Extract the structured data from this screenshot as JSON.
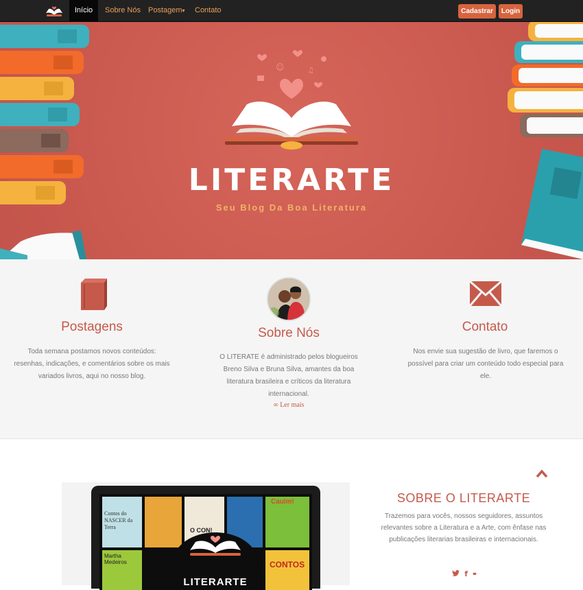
{
  "navbar": {
    "items": [
      "Início",
      "Sobre Nós",
      "Postagem",
      "Contato"
    ],
    "dropdown_caret": "▾",
    "register_label": "Cadastrar",
    "login_label": "Login"
  },
  "hero": {
    "title": "LITERARTE",
    "subtitle": "Seu Blog Da Boa Literatura"
  },
  "features": [
    {
      "icon": "book-icon",
      "title": "Postagens",
      "text": "Toda semana postamos novos conteúdos: resenhas, indicações, e comentários sobre os mais variados livros, aqui no nosso blog."
    },
    {
      "icon": "avatar",
      "title": "Sobre Nós",
      "text": "O LITERATE é administrado pelos blogueiros Breno Silva e Bruna Silva, amantes da boa literatura brasileira e críticos da literatura internacional.",
      "link": "Ler mais",
      "link_icon": "∞"
    },
    {
      "icon": "envelope-icon",
      "title": "Contato",
      "text": "Nos envie sua sugestão de livro, que faremos o possível para criar um conteúdo todo especial para ele."
    }
  ],
  "about": {
    "title": "SOBRE O LITERARTE",
    "text": "Trazemos para vocês, nossos seguidores, assuntos relevantes sobre a Literatura e a Arte, com ênfase nas publicações literarias brasileiras e internacionais.",
    "screen_logo": "LITERARTE",
    "poster_labels": [
      "Contos do NASCER da Terra",
      "Martha Medeiros",
      "Cauim!",
      "O CON!",
      "CONTOS"
    ],
    "social": {
      "twitter": "🐦",
      "facebook": "f",
      "flickr": "••"
    }
  },
  "colors": {
    "accent": "#c55a4b",
    "hero_bg": "#cb5a50",
    "nav_bg": "#222222",
    "button": "#d7643e",
    "nav_link": "#e8a05a"
  }
}
